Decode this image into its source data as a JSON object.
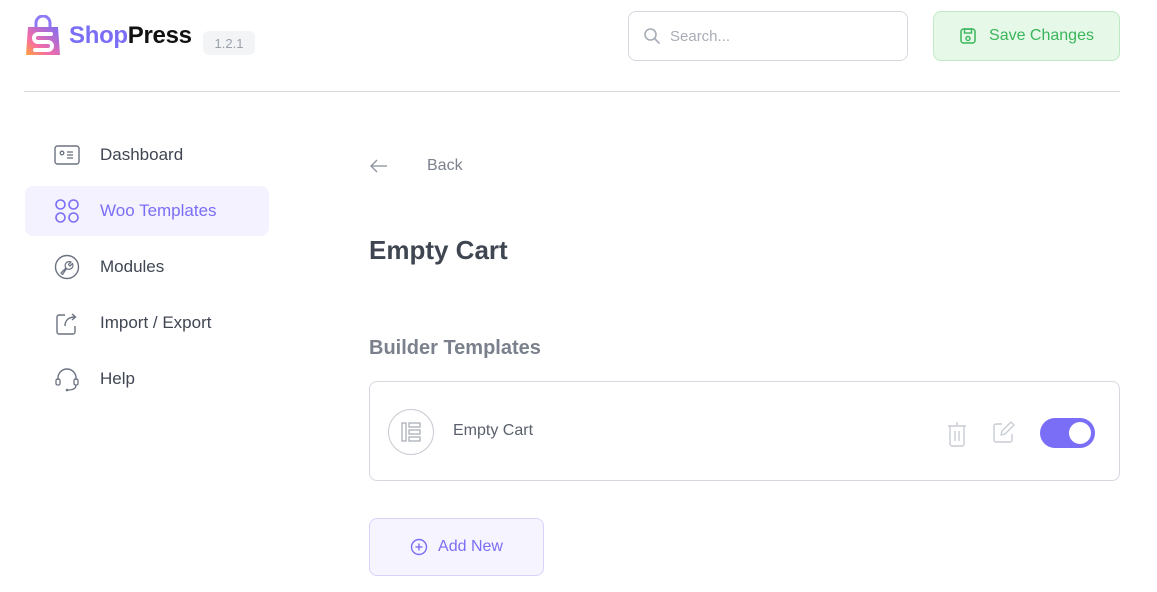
{
  "header": {
    "brand_part1": "Shop",
    "brand_part2": "Press",
    "version": "1.2.1",
    "search_placeholder": "Search...",
    "save_label": "Save Changes"
  },
  "sidebar": {
    "items": [
      {
        "label": "Dashboard",
        "icon": "dashboard-icon",
        "active": false
      },
      {
        "label": "Woo Templates",
        "icon": "grid-icon",
        "active": true
      },
      {
        "label": "Modules",
        "icon": "wrench-icon",
        "active": false
      },
      {
        "label": "Import / Export",
        "icon": "export-icon",
        "active": false
      },
      {
        "label": "Help",
        "icon": "headset-icon",
        "active": false
      }
    ]
  },
  "main": {
    "back_label": "Back",
    "page_title": "Empty Cart",
    "section_title": "Builder Templates",
    "templates": [
      {
        "name": "Empty Cart",
        "icon": "elementor-icon",
        "enabled": true
      }
    ],
    "add_new_label": "Add New"
  },
  "colors": {
    "accent": "#7b6ef6",
    "accent_bg": "#f3f2fe",
    "save_green": "#3ab55a",
    "save_bg": "#e6f8e8",
    "text": "#3f4652",
    "muted": "#7a818c",
    "border": "#d5d9df"
  }
}
